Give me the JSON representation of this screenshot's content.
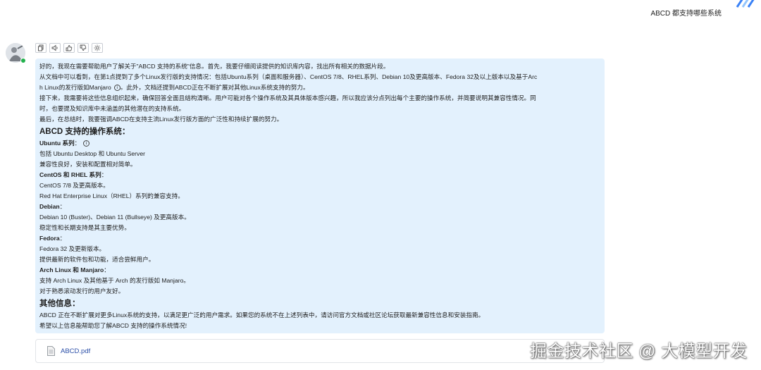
{
  "user_message": "ABCD 都支持哪些系统",
  "toolbar": {
    "icons": [
      "copy-icon",
      "speaker-icon",
      "thumbs-up-icon",
      "thumbs-down-icon",
      "sparkle-icon"
    ]
  },
  "answer": {
    "lines": [
      "好的，我现在需要帮助用户了解关于\"ABCD 支持的系统\"信息。首先，我要仔细阅读提供的知识库内容，找出所有相关的数据片段。",
      "从文档中可以看到，在第1点提到了多个Linux发行版的支持情况：包括Ubuntu系列（桌面和服务器）、CentOS 7/8、RHEL系列、Debian 10及更高版本、Fedora 32及以上版本以及基于Arc",
      "h Linux的发行版如Manjaro",
      "。此外，文档还提到ABCD正在不断扩展对其他Linux系统支持的努力。",
      "接下来，我需要将这些信息组织起来，确保回答全面且结构清晰。用户可能对各个操作系统及其具体版本感兴趣，所以我应该分点列出每个主要的操作系统，并简要说明其兼容性情况。同",
      "时，也要提及知识库中未涵盖的其他潜在的支持系统。",
      "最后，在总结时，我要强调ABCD在支持主流Linux发行版方面的广泛性和持续扩展的努力。"
    ],
    "heading_os": "ABCD 支持的操作系统：",
    "sections": [
      {
        "title": "Ubuntu 系列",
        "lines": [
          "包括 Ubuntu Desktop 和 Ubuntu Server",
          "兼容性良好，安装和配置相对简单。"
        ]
      },
      {
        "title": "CentOS 和 RHEL 系列",
        "lines": [
          "CentOS 7/8 及更高版本。",
          "Red Hat Enterprise Linux（RHEL）系列的兼容支持。"
        ]
      },
      {
        "title": "Debian",
        "lines": [
          "Debian 10 (Buster)、Debian 11 (Bullseye) 及更高版本。",
          "稳定性和长期支持是其主要优势。"
        ]
      },
      {
        "title": "Fedora",
        "lines": [
          "Fedora 32 及更新版本。",
          "提供最新的软件包和功能，适合尝鲜用户。"
        ]
      },
      {
        "title": "Arch Linux 和 Manjaro",
        "lines": [
          "支持 Arch Linux 及其他基于 Arch 的发行版如 Manjaro。",
          "对于熟悉滚动发行的用户友好。"
        ]
      }
    ],
    "heading_other": "其他信息：",
    "other_lines": [
      "ABCD 正在不断扩展对更多Linux系统的支持，以满足更广泛的用户需求。如果您的系统不在上述列表中，请访问官方文档或社区论坛获取最新兼容性信息和安装指南。",
      "希望以上信息能帮助您了解ABCD 支持的操作系统情况!"
    ],
    "colon": "：",
    "info_glyph": "i"
  },
  "attachment": {
    "name": "ABCD.pdf",
    "icon": "pdf-file-icon"
  },
  "watermark": "掘金技术社区 @ 大模型开发",
  "colors": {
    "answer_bg": "#e3f1fd",
    "link": "#2b4fa8",
    "online": "#22b14c"
  }
}
